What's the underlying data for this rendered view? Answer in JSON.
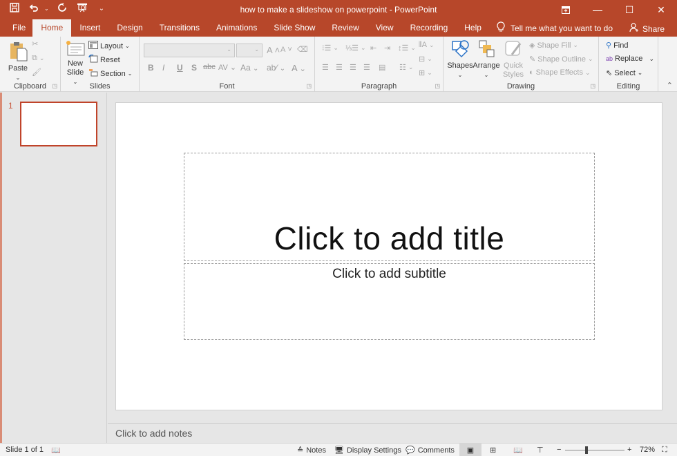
{
  "window": {
    "title": "how to make a slideshow on powerpoint  -  PowerPoint",
    "accent": "#b7472a",
    "controls": {
      "ribbon_display": "ribbon-display-icon",
      "minimize": "—",
      "maximize": "☐",
      "close": "✕"
    }
  },
  "qat": {
    "save": "save-icon",
    "undo": "undo-icon",
    "redo": "redo-icon",
    "start_from_beginning": "slideshow-icon",
    "customize": "customize-icon"
  },
  "tabs": [
    {
      "label": "File"
    },
    {
      "label": "Home",
      "active": true
    },
    {
      "label": "Insert"
    },
    {
      "label": "Design"
    },
    {
      "label": "Transitions"
    },
    {
      "label": "Animations"
    },
    {
      "label": "Slide Show"
    },
    {
      "label": "Review"
    },
    {
      "label": "View"
    },
    {
      "label": "Recording"
    },
    {
      "label": "Help"
    }
  ],
  "tell_me": {
    "placeholder": "Tell me what you want to do"
  },
  "share": {
    "label": "Share"
  },
  "ribbon": {
    "clipboard": {
      "label": "Clipboard",
      "paste": "Paste"
    },
    "slides": {
      "label": "Slides",
      "new_slide": "New",
      "new_slide2": "Slide",
      "layout": "Layout",
      "reset": "Reset",
      "section": "Section"
    },
    "font": {
      "label": "Font",
      "font_name": "",
      "font_size": "",
      "bold": "B",
      "italic": "I",
      "underline": "U",
      "shadow": "S",
      "strike": "abc",
      "spacing": "AV",
      "case": "Aa",
      "grow": "A",
      "shrink": "A",
      "color": "A"
    },
    "paragraph": {
      "label": "Paragraph"
    },
    "drawing": {
      "label": "Drawing",
      "shapes": "Shapes",
      "arrange": "Arrange",
      "quick_styles": "Quick",
      "quick_styles2": "Styles",
      "shape_fill": "Shape Fill",
      "shape_outline": "Shape Outline",
      "shape_effects": "Shape Effects"
    },
    "editing": {
      "label": "Editing",
      "find": "Find",
      "replace": "Replace",
      "select": "Select"
    }
  },
  "slides_pane": {
    "slides": [
      {
        "number": "1"
      }
    ]
  },
  "slide": {
    "title_placeholder": "Click to add title",
    "subtitle_placeholder": "Click to add subtitle"
  },
  "notes": {
    "placeholder": "Click to add notes"
  },
  "status": {
    "slide_indicator": "Slide 1 of 1",
    "notes": "Notes",
    "display_settings": "Display Settings",
    "comments": "Comments",
    "zoom_level": "72%",
    "zoom_fraction": 0.36
  }
}
